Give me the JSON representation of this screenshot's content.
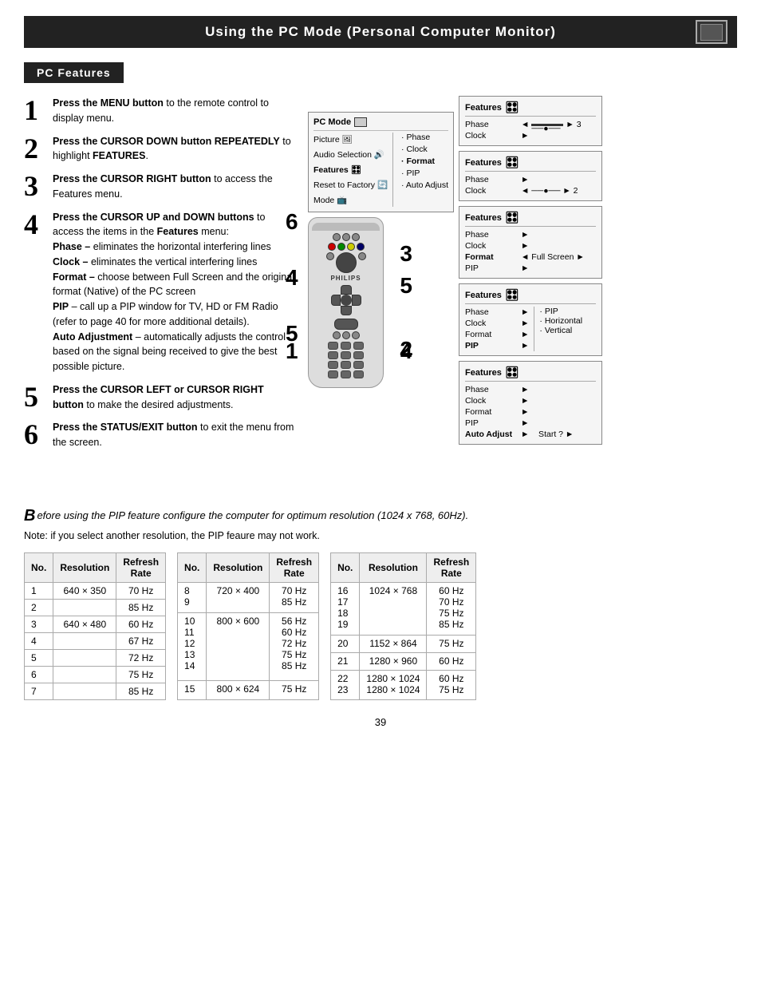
{
  "header": {
    "title": "Using the PC Mode (Personal Computer Monitor)"
  },
  "section": {
    "title": "PC Features"
  },
  "steps": [
    {
      "num": "1",
      "text_bold": "Press the MENU button",
      "text_rest": " to the remote control to display menu."
    },
    {
      "num": "2",
      "text_bold": "Press the CURSOR DOWN button REPEATEDLY",
      "text_rest": " to highlight FEATURES."
    },
    {
      "num": "3",
      "text_bold": "Press the CURSOR RIGHT button",
      "text_rest": " to access the Features menu."
    },
    {
      "num": "4",
      "text_bold": "Press the CURSOR UP and DOWN buttons",
      "text_rest": " to access the items in the Features menu:"
    },
    {
      "num": "4",
      "label": "Phase",
      "text_rest": "– eliminates the horizontal interfering lines"
    },
    {
      "num": "4",
      "label": "Clock",
      "text_rest": "– eliminates the vertical interfering lines"
    },
    {
      "num": "4",
      "label": "Format",
      "text_rest": "– choose between Full Screen and the original format (Native) of the PC screen"
    },
    {
      "num": "4",
      "label": "PIP",
      "text_rest": "– call up a PIP window for TV, HD or FM Radio (refer to page 40 for more additional details)."
    },
    {
      "num": "4",
      "label": "Auto Adjustment",
      "text_rest": "– automatically adjusts the control based on the signal being received to give the best possible picture."
    },
    {
      "num": "5",
      "text_bold": "Press the CURSOR LEFT or CURSOR RIGHT button",
      "text_rest": " to make the desired adjustments."
    },
    {
      "num": "6",
      "text_bold": "Press the STATUS/EXIT button",
      "text_rest": " to exit the menu from the screen."
    }
  ],
  "menu_panel": {
    "title": "PC Mode",
    "rows": [
      {
        "label": "Picture",
        "items": [
          "Phase"
        ]
      },
      {
        "label": "Audio Selection",
        "items": [
          "Clock"
        ]
      },
      {
        "label": "Features",
        "items": [
          "Format"
        ],
        "highlight": true
      },
      {
        "label": "Reset to Factory",
        "items": [
          "PIP"
        ]
      },
      {
        "label": "Mode",
        "items": [
          "Auto Adjust"
        ]
      }
    ]
  },
  "feature_panels": [
    {
      "title": "Features",
      "rows": [
        {
          "name": "Phase",
          "value": "◄ ——●—— ► 3"
        },
        {
          "name": "Clock",
          "value": "►"
        }
      ]
    },
    {
      "title": "Features",
      "rows": [
        {
          "name": "Phase",
          "value": "►"
        },
        {
          "name": "Clock",
          "value": "◄ ——●—— ► 2"
        }
      ]
    },
    {
      "title": "Features",
      "rows": [
        {
          "name": "Phase",
          "value": "►"
        },
        {
          "name": "Clock",
          "value": "►"
        },
        {
          "name": "Format",
          "value": "◄ Full Screen ►"
        },
        {
          "name": "PIP",
          "value": "►"
        }
      ]
    },
    {
      "title": "Features",
      "rows": [
        {
          "name": "Phase",
          "value": "►"
        },
        {
          "name": "Clock",
          "value": "►"
        },
        {
          "name": "Format",
          "value": "►"
        },
        {
          "name": "PIP",
          "value": "►",
          "bold": true
        }
      ],
      "sub_items": [
        "• PIP",
        "• Horizontal",
        "• Vertical"
      ]
    },
    {
      "title": "Features",
      "rows": [
        {
          "name": "Phase",
          "value": "►"
        },
        {
          "name": "Clock",
          "value": "►"
        },
        {
          "name": "Format",
          "value": "►"
        },
        {
          "name": "PIP",
          "value": "►"
        },
        {
          "name": "Auto Adjust",
          "value": "►",
          "extra": "Start ? ►"
        }
      ]
    }
  ],
  "italic_note": "efore using the PIP feature configure the computer for optimum resolution (1024 x 768, 60Hz).",
  "note_text": "Note: if you select another resolution, the PIP feaure may not work.",
  "tables": {
    "table1": {
      "headers": [
        "No.",
        "Resolution",
        "Refresh Rate"
      ],
      "rows": [
        [
          "1",
          "640 × 350",
          "70 Hz"
        ],
        [
          "2",
          "",
          "85 Hz"
        ],
        [
          "3",
          "640 × 480",
          "60 Hz"
        ],
        [
          "4",
          "",
          "67 Hz"
        ],
        [
          "5",
          "",
          "72 Hz"
        ],
        [
          "6",
          "",
          "75 Hz"
        ],
        [
          "7",
          "",
          "85 Hz"
        ]
      ]
    },
    "table2": {
      "headers": [
        "No.",
        "Resolution",
        "Refresh Rate"
      ],
      "rows": [
        [
          "8",
          "720 × 400",
          "70 Hz"
        ],
        [
          "9",
          "",
          "85 Hz"
        ],
        [
          "10",
          "800 × 600",
          "56 Hz"
        ],
        [
          "11",
          "",
          "60 Hz"
        ],
        [
          "12",
          "",
          "72 Hz"
        ],
        [
          "13",
          "",
          "75 Hz"
        ],
        [
          "14",
          "",
          "85 Hz"
        ],
        [
          "15",
          "800 × 624",
          "75 Hz"
        ]
      ]
    },
    "table3": {
      "headers": [
        "No.",
        "Resolution",
        "Refresh Rate"
      ],
      "rows": [
        [
          "16",
          "1024 × 768",
          "60 Hz"
        ],
        [
          "17",
          "",
          "70 Hz"
        ],
        [
          "18",
          "",
          "75 Hz"
        ],
        [
          "19",
          "",
          "85 Hz"
        ],
        [
          "20",
          "1152 × 864",
          "75 Hz"
        ],
        [
          "21",
          "1280 × 960",
          "60 Hz"
        ],
        [
          "22",
          "1280 × 1024",
          "60 Hz"
        ],
        [
          "23",
          "1280 × 1024",
          "75 Hz"
        ]
      ]
    }
  },
  "page_number": "39"
}
